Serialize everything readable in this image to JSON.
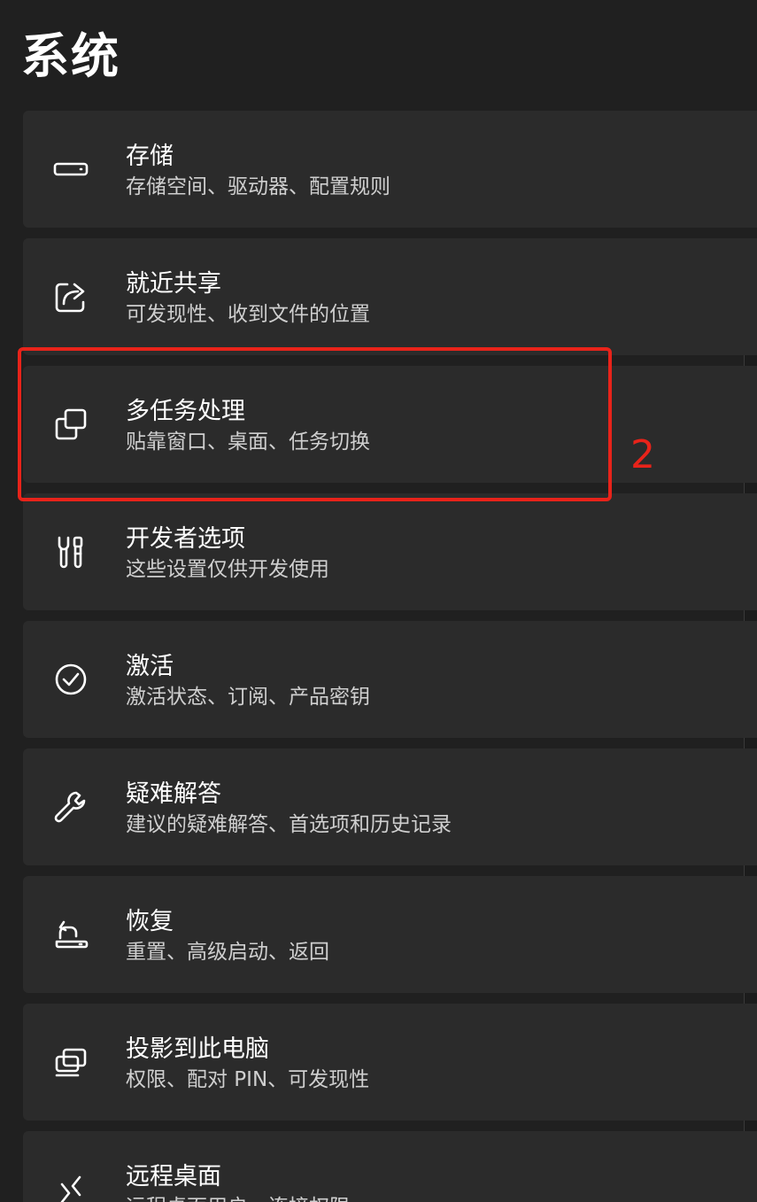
{
  "header": {
    "title": "系统"
  },
  "items": [
    {
      "icon": "storage-icon",
      "title": "存储",
      "subtitle": "存储空间、驱动器、配置规则"
    },
    {
      "icon": "share-icon",
      "title": "就近共享",
      "subtitle": "可发现性、收到文件的位置"
    },
    {
      "icon": "multitasking-icon",
      "title": "多任务处理",
      "subtitle": "贴靠窗口、桌面、任务切换"
    },
    {
      "icon": "developer-tools-icon",
      "title": "开发者选项",
      "subtitle": "这些设置仅供开发使用"
    },
    {
      "icon": "check-circle-icon",
      "title": "激活",
      "subtitle": "激活状态、订阅、产品密钥"
    },
    {
      "icon": "wrench-icon",
      "title": "疑难解答",
      "subtitle": "建议的疑难解答、首选项和历史记录"
    },
    {
      "icon": "recovery-icon",
      "title": "恢复",
      "subtitle": "重置、高级启动、返回"
    },
    {
      "icon": "projection-icon",
      "title": "投影到此电脑",
      "subtitle": "权限、配对 PIN、可发现性"
    },
    {
      "icon": "remote-desktop-icon",
      "title": "远程桌面",
      "subtitle": "远程桌面用户、连接权限"
    }
  ],
  "annotation": {
    "label": "2",
    "color": "#e8231a"
  },
  "colors": {
    "background": "#202020",
    "card": "#2b2b2b",
    "text": "#ffffff",
    "subtext": "#cfcfcf"
  }
}
